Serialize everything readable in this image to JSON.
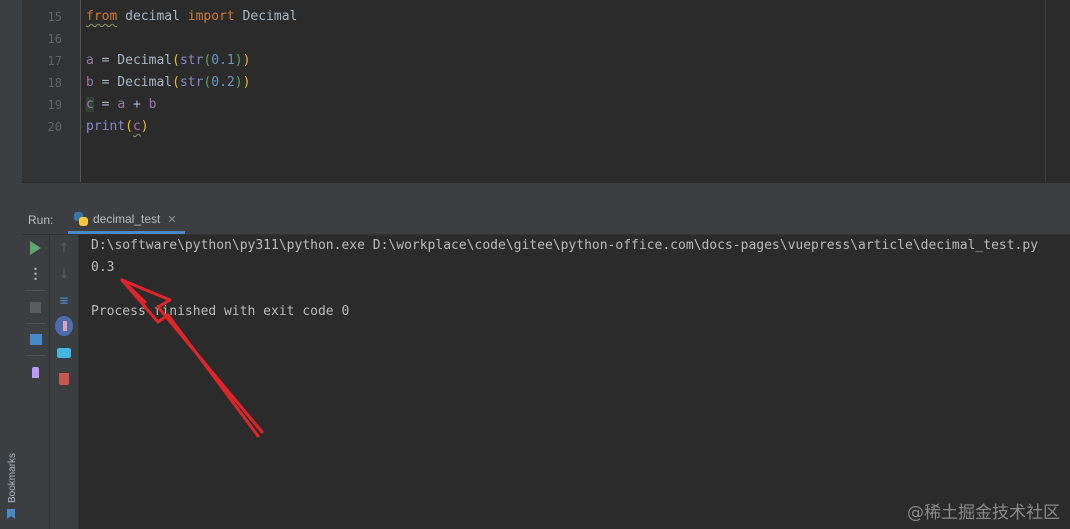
{
  "editor": {
    "line_numbers": [
      "15",
      "16",
      "17",
      "18",
      "19",
      "20"
    ],
    "line15": {
      "kw1": "from",
      "mod": " decimal ",
      "kw2": "import",
      "cls": " Decimal"
    },
    "line17": {
      "var": "a",
      "eq": " = Decimal",
      "p1o": "(",
      "fn": "str",
      "p2o": "(",
      "num": "0.1",
      "p2c": ")",
      "p1c": ")"
    },
    "line18": {
      "var": "b",
      "eq": " = Decimal",
      "p1o": "(",
      "fn": "str",
      "p2o": "(",
      "num": "0.2",
      "p2c": ")",
      "p1c": ")"
    },
    "line19": {
      "var": "c",
      "eq": " = ",
      "a": "a",
      "plus": " + ",
      "b": "b"
    },
    "line20": {
      "fn": "print",
      "po": "(",
      "arg": "c",
      "pc": ")"
    }
  },
  "run_window": {
    "label": "Run:",
    "tab_label": "decimal_test",
    "tab_close": "✕"
  },
  "console": {
    "lines": [
      "D:\\software\\python\\py311\\python.exe D:\\workplace\\code\\gitee\\python-office.com\\docs-pages\\vuepress\\article\\decimal_test.py",
      "0.3",
      "",
      "Process finished with exit code 0"
    ]
  },
  "sidebar": {
    "bookmarks_label": "Bookmarks"
  },
  "icons": {
    "rerun": "play-icon",
    "more": "more-vertical-icon",
    "up": "arrow-up-icon",
    "down": "arrow-down-icon",
    "stop": "stop-icon",
    "soft_wrap": "soft-wrap-icon",
    "scroll_end": "scroll-to-end-icon",
    "layout": "layout-icon",
    "print": "print-icon",
    "pin": "pin-icon",
    "delete": "trash-icon"
  },
  "colors": {
    "annotation": "#e0242b",
    "keyword": "#cc7832",
    "variable": "#9876aa",
    "number": "#6897bb",
    "run_green": "#59a869"
  },
  "watermark": "@稀土掘金技术社区"
}
